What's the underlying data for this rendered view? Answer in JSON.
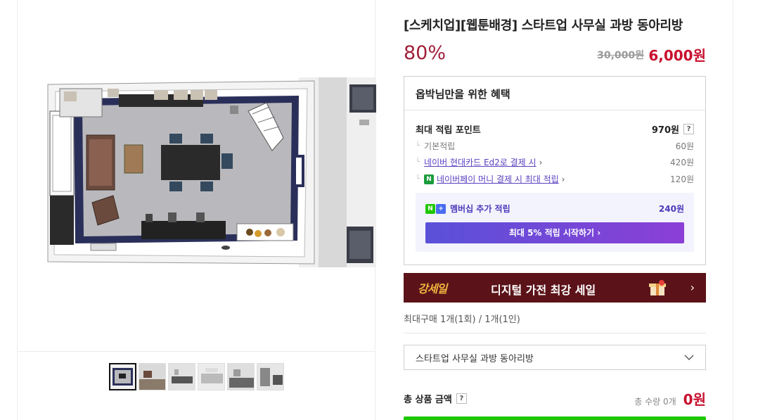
{
  "product": {
    "title": "[스케치업][웹툰배경] 스타트업 사무실 과방 동아리방",
    "discount": "80%",
    "original_price": "30,000원",
    "sale_price": "6,000원"
  },
  "benefits": {
    "header": "옵박님만을 위한 혜택",
    "max_points_label": "최대 적립 포인트",
    "max_points_value": "970원",
    "help_icon": "?",
    "rows": [
      {
        "label": "기본적립",
        "value": "60원"
      },
      {
        "label": "네이버 현대카드 Ed2로 결제 시",
        "value": "420원"
      },
      {
        "label": "네이버페이 머니 결제 시 최대 적립",
        "value": "120원"
      }
    ],
    "npay_badge": "N",
    "membership": {
      "label": "멤버십 추가 적립",
      "value": "240원",
      "icon_n": "N",
      "icon_plus": "+",
      "button": "최대 5% 적립 시작하기 ›"
    }
  },
  "banner": {
    "logo": "강세일",
    "text": "디지털 가전 최강 세일",
    "arrow": "›"
  },
  "purchase": {
    "max_buy": "최대구매 1개(1회) / 1개(1인)",
    "option_selected": "스타트업 사무실 과방 동아리방",
    "total_label": "총 상품 금액",
    "total_qty": "총 수량 0개",
    "total_price": "0원"
  },
  "colors": {
    "discount": "#a0203a",
    "price": "#c8102e",
    "banner_bg": "#5b1319",
    "member_bg": "#f3f3fd",
    "accent_green": "#1ec800"
  },
  "thumbnails": {
    "count": 6,
    "active_index": 0
  }
}
